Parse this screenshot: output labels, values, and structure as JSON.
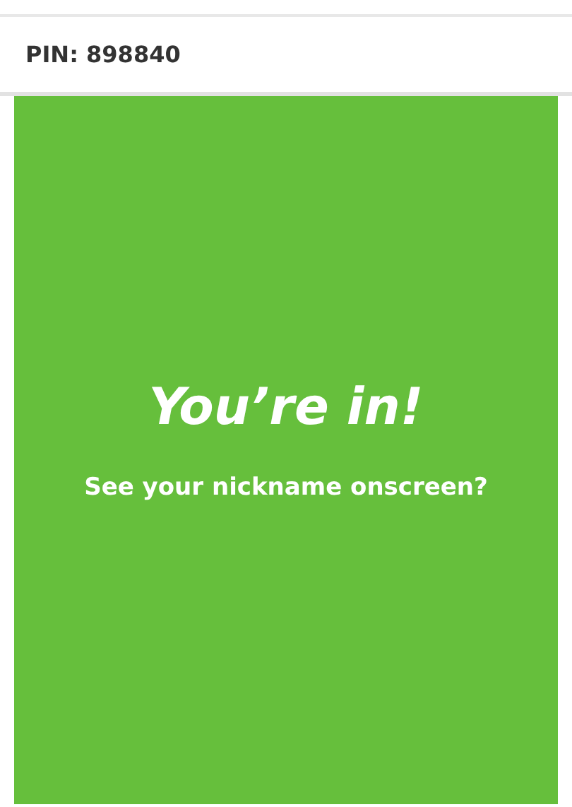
{
  "header": {
    "pin": "PIN: 898840"
  },
  "status": {
    "title": "You’re in!",
    "message": "See your nickname onscreen?"
  }
}
